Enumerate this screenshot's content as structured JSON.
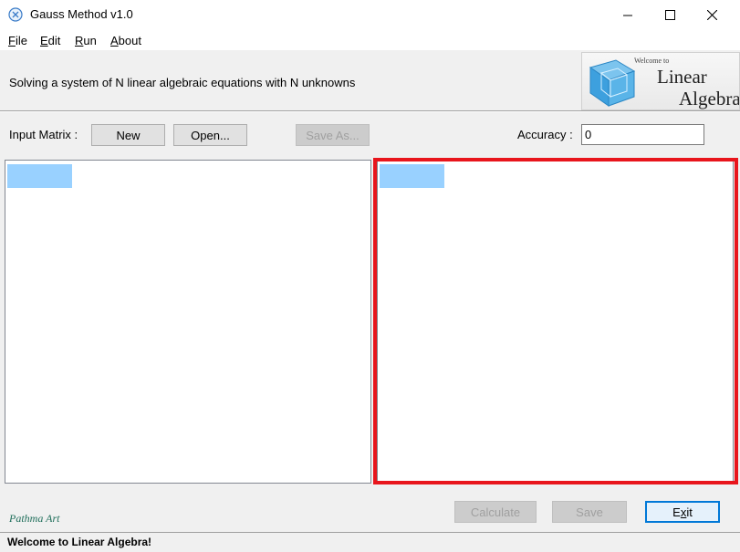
{
  "window": {
    "title": "Gauss Method v1.0",
    "icon": "app-logo-icon",
    "controls": [
      "minimize-icon",
      "maximize-icon",
      "close-icon"
    ]
  },
  "menu": {
    "items": [
      {
        "label": "File",
        "mnemonic": "F",
        "rest": "ile"
      },
      {
        "label": "Edit",
        "mnemonic": "E",
        "rest": "dit"
      },
      {
        "label": "Run",
        "mnemonic": "R",
        "rest": "un"
      },
      {
        "label": "About",
        "mnemonic": "A",
        "rest": "bout"
      }
    ]
  },
  "banner": {
    "subtitle": "Solving a system of N linear algebraic equations with N unknowns",
    "logo": {
      "welcome": "Welcome to",
      "line1": "Linear",
      "line2": "Algebra"
    }
  },
  "toolbar": {
    "input_matrix_label": "Input Matrix :",
    "new_label": "New",
    "open_label": "Open...",
    "save_as_label": "Save As...",
    "accuracy_label": "Accuracy :",
    "accuracy_value": "0"
  },
  "footer": {
    "signature": "Pathma Art",
    "calculate_label": "Calculate",
    "save_label": "Save",
    "exit_label": "Exit",
    "exit_mnemonic": "x"
  },
  "status": {
    "text": "Welcome to Linear Algebra!"
  },
  "colors": {
    "highlight": "#e8151c",
    "selection": "#99d1ff",
    "default_button_border": "#0078d7"
  }
}
